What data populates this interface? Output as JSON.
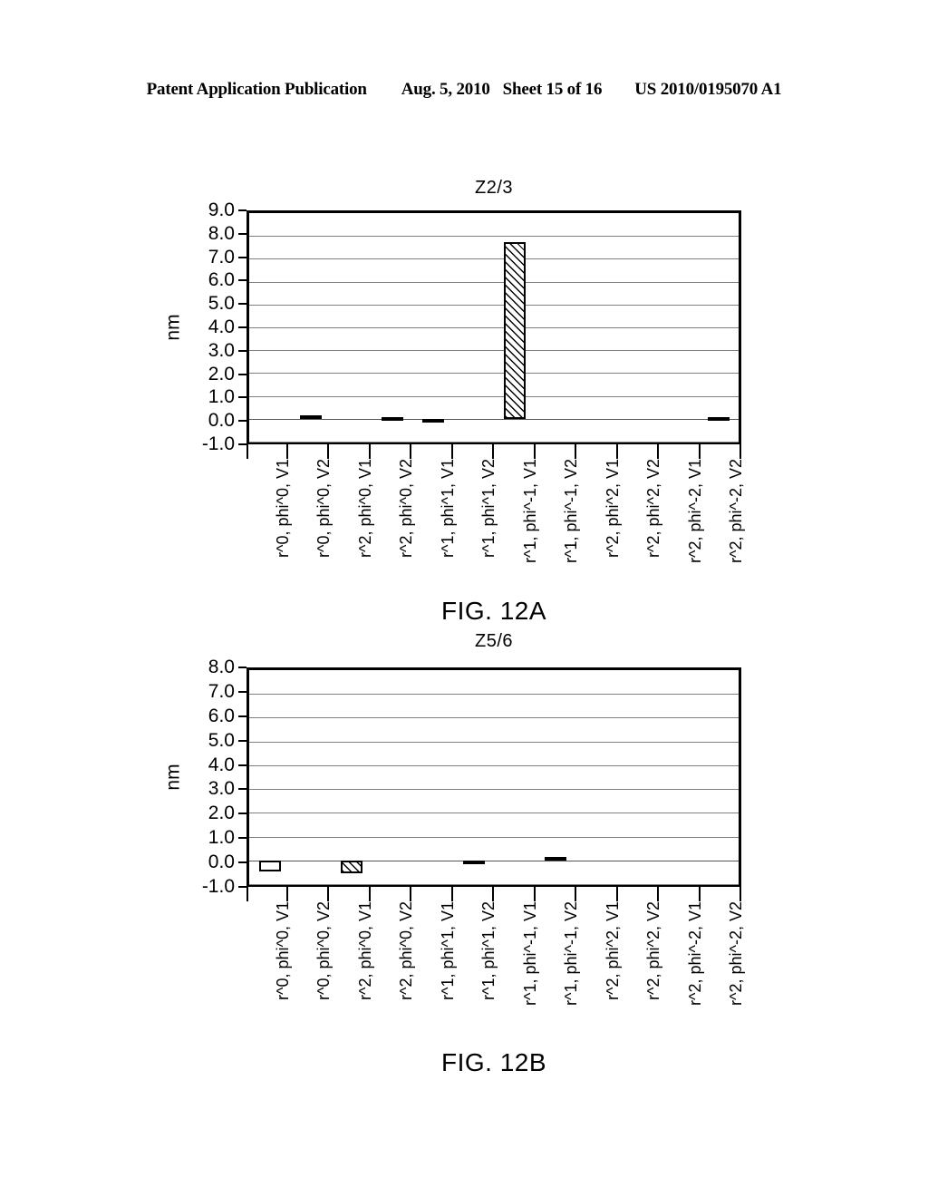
{
  "header": {
    "publication": "Patent Application Publication",
    "date": "Aug. 5, 2010",
    "sheet": "Sheet 15 of 16",
    "patent_number": "US 2010/0195070 A1"
  },
  "figures": [
    {
      "caption": "FIG. 12A",
      "chart_data": {
        "type": "bar",
        "title": "Z2/3",
        "xlabel": "",
        "ylabel": "nm",
        "ylim": [
          -1.0,
          9.0
        ],
        "yticks": [
          "9.0",
          "8.0",
          "7.0",
          "6.0",
          "5.0",
          "4.0",
          "3.0",
          "2.0",
          "1.0",
          "0.0",
          "-1.0"
        ],
        "ytick_values": [
          9.0,
          8.0,
          7.0,
          6.0,
          5.0,
          4.0,
          3.0,
          2.0,
          1.0,
          0.0,
          -1.0
        ],
        "grid": true,
        "legend": "none",
        "categories": [
          "r^0, phi^0, V1",
          "r^0, phi^0, V2",
          "r^2, phi^0, V1",
          "r^2, phi^0, V2",
          "r^1, phi^1, V1",
          "r^1, phi^1, V2",
          "r^1, phi^-1, V1",
          "r^1, phi^-1, V2",
          "r^2, phi^2, V1",
          "r^2, phi^2, V2",
          "r^2, phi^-2, V1",
          "r^2, phi^-2, V2"
        ],
        "values": [
          0.0,
          0.17,
          0.0,
          0.09,
          -0.09,
          0.0,
          7.75,
          0.0,
          0.0,
          0.0,
          0.0,
          0.09
        ],
        "fills": [
          "none",
          "solid",
          "none",
          "solid",
          "solid",
          "none",
          "hatch",
          "none",
          "none",
          "none",
          "none",
          "solid"
        ]
      }
    },
    {
      "caption": "FIG. 12B",
      "chart_data": {
        "type": "bar",
        "title": "Z5/6",
        "xlabel": "",
        "ylabel": "nm",
        "ylim": [
          -1.0,
          8.0
        ],
        "yticks": [
          "8.0",
          "7.0",
          "6.0",
          "5.0",
          "4.0",
          "3.0",
          "2.0",
          "1.0",
          "0.0",
          "-1.0"
        ],
        "ytick_values": [
          8.0,
          7.0,
          6.0,
          5.0,
          4.0,
          3.0,
          2.0,
          1.0,
          0.0,
          -1.0
        ],
        "grid": true,
        "legend": "none",
        "categories": [
          "r^0, phi^0, V1",
          "r^0, phi^0, V2",
          "r^2, phi^0, V1",
          "r^2, phi^0, V2",
          "r^1, phi^1, V1",
          "r^1, phi^1, V2",
          "r^1, phi^-1, V1",
          "r^1, phi^-1, V2",
          "r^2, phi^2, V1",
          "r^2, phi^2, V2",
          "r^2, phi^-2, V1",
          "r^2, phi^-2, V2"
        ],
        "values": [
          -0.45,
          0.0,
          -0.55,
          0.0,
          0.0,
          -0.16,
          0.0,
          0.13,
          0.0,
          0.0,
          0.0,
          0.0
        ],
        "fills": [
          "solid",
          "none",
          "hatch",
          "none",
          "none",
          "solid",
          "none",
          "hatch",
          "none",
          "none",
          "none",
          "none"
        ]
      }
    }
  ],
  "colors": {
    "axis": "#000000",
    "grid": "#808080",
    "background": "#ffffff"
  }
}
